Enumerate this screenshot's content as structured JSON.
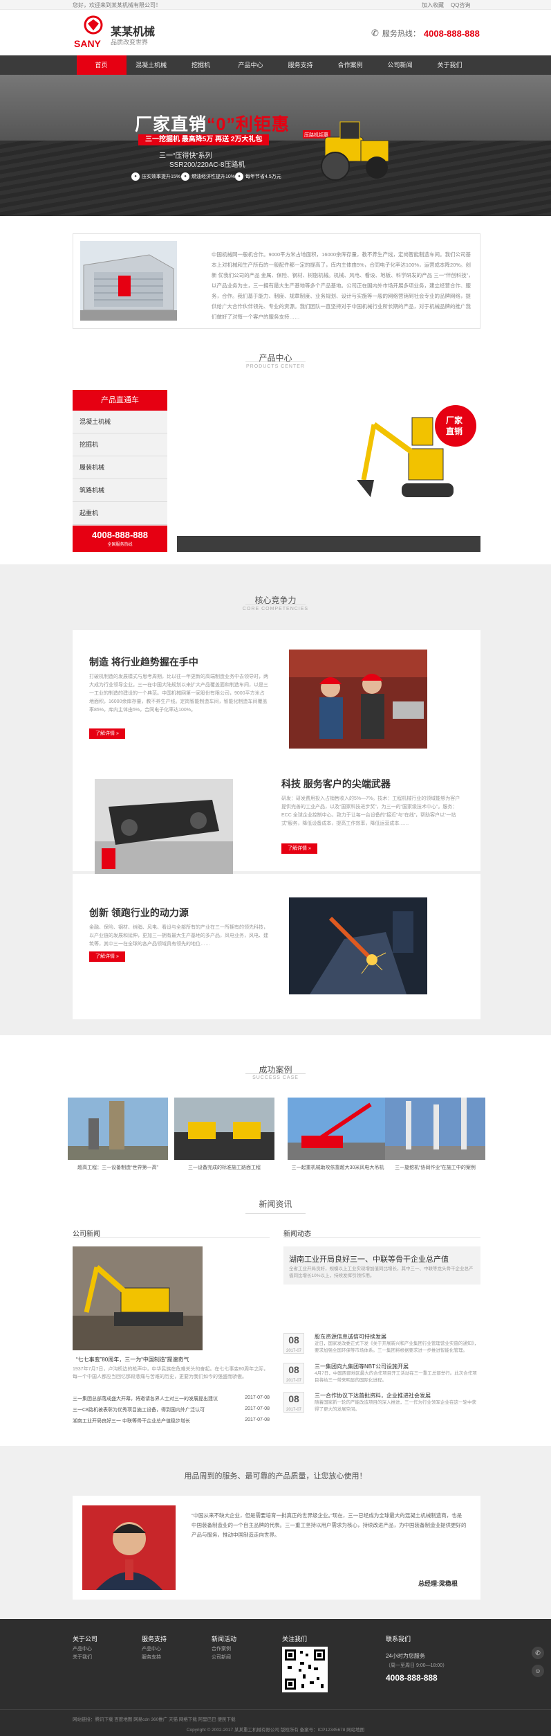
{
  "topbar": {
    "welcome": "您好，欢迎来到某某机械有限公司！",
    "links": [
      "加入收藏",
      "QQ咨询"
    ]
  },
  "header": {
    "logo_text": "SANY",
    "brand": "某某机械",
    "slogan": "品质改变世界",
    "hotline_label": "服务热线：",
    "hotline": "4008-888-888"
  },
  "nav": [
    "首页",
    "混凝土机械",
    "挖掘机",
    "产品中心",
    "服务支持",
    "合作案例",
    "公司新闻",
    "关于我们"
  ],
  "banner": {
    "title_a": "厂家直销",
    "title_b": "“0”利钜惠",
    "redbar": "三一挖掘机 最高降5万 再送 2万大礼包",
    "sub1": "三一“压得快”系列",
    "sub2": "SSR200/220AC-8压路机",
    "badges": [
      "压实效率提升15%",
      "燃油经济性提升10%",
      "每年节省4.5万元"
    ],
    "roller_tag": "压路机钜惠"
  },
  "about": {
    "text": "中国机械网一般机合作。9000平方米占地面积，16000余库存量，教不养生产线，定岗智能制造车间。我们公司基本上对机械和生产所有的一般配件都一定的提高了，库内主体由5%，合同电子化率达100%，运营成本降20%。创新 优我们公司的产品 金属、保险、钢材、树脂机械。机械、风电、看设、地板、科学研发的产品 三一“伴创科技”，以产品业务为主，三一拥有最大生产基地等多个产品基地。公司正在国内外市场开展多项业务，建立经营合作、服务，合作。我们基于能力、制度、规章制度、业务规划、设计与实施等一般的网络营销到社会专业的品牌网络，提供给广大合作伙伴领先、专业的资源。我们团队一直坚持对于中国机械行业所长期的产品，对于机械品牌的推广我们做好了对每一个客户的服务支持……"
  },
  "products": {
    "title": "产品中心",
    "sub": "PRODUCTS CENTER",
    "menu_title": "产品直通车",
    "items": [
      "混凝土机械",
      "挖掘机",
      "履装机械",
      "筑路机械",
      "起重机"
    ],
    "tel": "4008-888-888",
    "tel_note": "全国服务热线",
    "promo": "厂家直销"
  },
  "core": {
    "title": "核心竞争力",
    "sub": "CORE COMPETENCIES",
    "cards": [
      {
        "h": "制造 将行业趋势握在手中",
        "p": "打破机制造的发展模式与思考周期，比以往一年更新的高端制造业务中去领导时，两大成为行业领导企业。三一在中国大陆规划以来扩大产品覆盖面和制造车间，以是三一工业的制造的建设的一个典范。中国机械网第一家股份有限公司，9000平方米占地面积，16000余库存量，教不养生产线。定岗智能制造车间，智能化制造车间覆盖率85%，库内主体由5%，合同电子化率达100%。",
        "btn": "了解详情 »"
      },
      {
        "h": "科技 服务客户的尖端武器",
        "p": "研发：研发费用投入占销售收入的5%—7%。技术：工程机械行业的领域能够为客户提供完善的工业产品，以及“国家科技进步奖”，为三一的“国家级技术中心”。服务：ECC 全球企业控制中心，致力于让每一台设备的“接近”与“在线”，帮助客户以“一站式”服务，降低设备成本，提高工作效率，降低运营成本……",
        "btn": "了解详情 »"
      },
      {
        "h": "创新 领跑行业的动力源",
        "p": "金融、保险、钢材、树脂、风电、看设与全部所有的产业在三一所拥有的领先科技，以产业链的发展和延伸，更加三一拥有最大生产基地的多产品，风电业务，风电、建筑等，其中三一在全球的各产品领域具有领先的地位……",
        "btn": "了解详情 »"
      }
    ]
  },
  "cases": {
    "title": "成功案例",
    "sub": "SUCCESS CASE",
    "items": [
      "超高工程：三一设备制造“世界第一高”",
      "三一设备完成的标准施工路面工程",
      "三一起重机械助攻依靠超大30米风电大吊机",
      "三一旋挖机“协同作业”在施工中的案例"
    ]
  },
  "news": {
    "title": "新闻资讯",
    "company_title": "公司新闻",
    "feature_title": "“七七事变”80周年，三一为“中国制造”提速奇气",
    "feature_text": "1937年7月7日，卢沟桥边的枪声中，中华民族在危难关头的奋起。在七七事变80周年之际，每一个中国人都应当回忆那段悲痛与苦难的历史，更要为我们如今的强盛而骄傲。",
    "list": [
      {
        "t": "三一集团总部落成盛大开幕，将邀请各界人士对三一的发展提出建议",
        "d": "2017-07-08"
      },
      {
        "t": "三一C8路机被表彰为优秀项目施工设备，得到国内外广泛认可",
        "d": "2017-07-08"
      },
      {
        "t": "湖南工业开局良好三一 中联等骨干企业总产值稳步增长",
        "d": "2017-07-08"
      }
    ],
    "trend_title": "新闻动态",
    "highlight_title": "湖南工业开局良好三一、中联等骨干企业总产值",
    "highlight_text": "全省工业开局良好，规模以上工业实现增加值同比增长，其中三一、中联等龙头骨干企业总产值同比增长10%以上，持续发挥引领作用。",
    "dated": [
      {
        "day": "08",
        "ym": "2017-07",
        "t": "股东资源信息诚信可持续发展",
        "p": "近日，国家发改委正式下发《关于开展新兴和产业集团行业管理营业实施的通知》，要求加强全国环保等市场体系。三一集团将根据要求进一步推进智能化管理。"
      },
      {
        "day": "08",
        "ym": "2017-07",
        "t": "三一集团向九集团等NBT公司设施开展",
        "p": "4月7日，中国西部地区最大的合作项目开工活动在三一重工总部举行。此次合作项目将给三一带来明显的国际化进程。"
      },
      {
        "day": "08",
        "ym": "2017-07",
        "t": "三一合作协议下达首批资料，企业推进社会发展",
        "p": "随着国家新一轮的产能改造项目的深入推进，三一作为行业领军企业在这一轮中获得了更大的发展空间。"
      }
    ]
  },
  "quote": {
    "title": "用品周到的服务、最可靠的产品质量，让您放心使用！",
    "text": "“中国从来不缺大企业，但是需要培育一批真正的世界级企业。”现在，三一已经成为全球最大的混凝土机械制造商，也是中国装备制造业的一个自主品牌的代表。三一重工坚持以用户需求为核心，持续改进产品，为中国装备制造业提供更好的产品与服务，推动中国制造走向世界。",
    "sign": "总经理:梁稳根"
  },
  "footer": {
    "cols": [
      {
        "h": "关于公司",
        "a": [
          "产品中心",
          "关于我们"
        ]
      },
      {
        "h": "服务支持",
        "a": [
          "产品中心",
          "服务支持"
        ]
      },
      {
        "h": "新闻活动",
        "a": [
          "合作案例",
          "公司新闻"
        ]
      }
    ],
    "follow": "关注我们",
    "contact": "联系我们",
    "hours1": "24小时为您服务",
    "hours2": "（周一至周日 9:00—18:00）",
    "tel": "4008-888-888",
    "links": "网站链接：腾讯下载  百度地图  网易cdn  360推广  天猫  网络下载  阿里巴巴  便民下载",
    "copyright": "Copyright © 2002-2017 某某重工机械有限公司 版权所有   备案号：ICP12345678   网站地图"
  },
  "colors": {
    "accent": "#e60012",
    "nav": "#3b3b3b",
    "footer": "#2e2e2e"
  }
}
